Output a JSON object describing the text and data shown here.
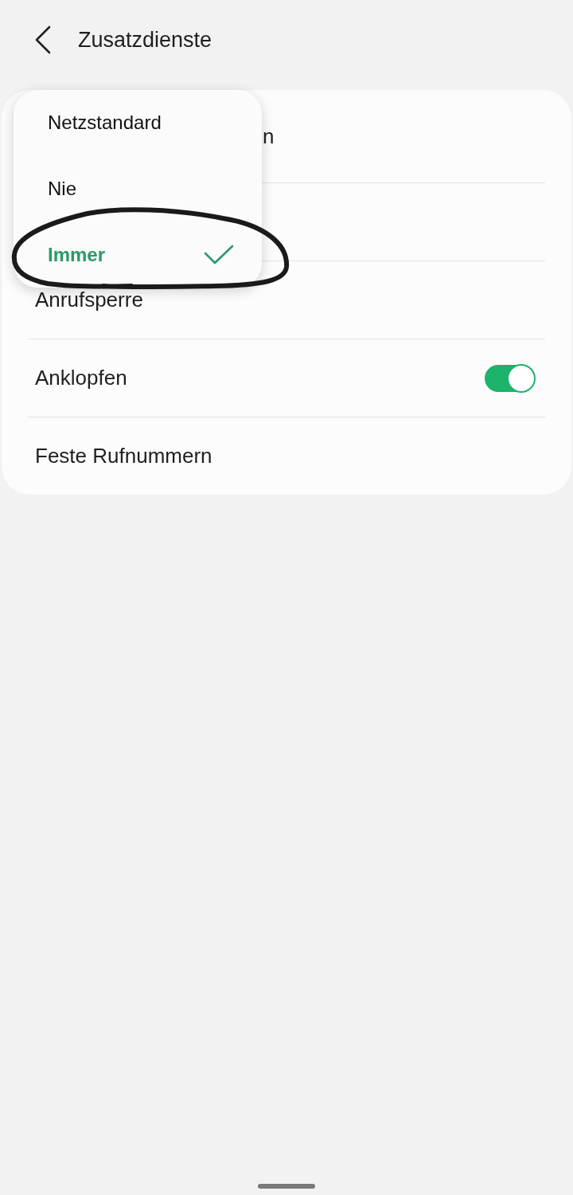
{
  "header": {
    "title": "Zusatzdienste"
  },
  "card": {
    "rows": [
      {
        "kind": "covered",
        "label": "n"
      },
      {
        "kind": "covered"
      },
      {
        "kind": "plain",
        "label": "Anrufsperre"
      },
      {
        "kind": "switch",
        "label": "Anklopfen",
        "on": true
      },
      {
        "kind": "plain",
        "label": "Feste Rufnummern"
      }
    ]
  },
  "popup_menu": {
    "items": [
      {
        "label": "Netzstandard",
        "selected": false
      },
      {
        "label": "Nie",
        "selected": false
      },
      {
        "label": "Immer",
        "selected": true
      }
    ]
  }
}
